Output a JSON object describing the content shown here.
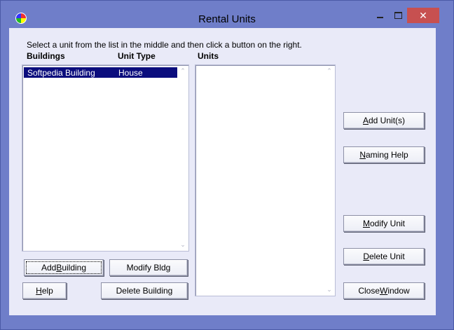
{
  "window": {
    "title": "Rental Units"
  },
  "instructions": "Select a unit from the list in the middle and then click a button on the right.",
  "headers": {
    "buildings": "Buildings",
    "unit_type": "Unit Type",
    "units": "Units"
  },
  "buildings_list": [
    {
      "building": "Softpedia Building",
      "unit_type": "House",
      "selected": true
    }
  ],
  "units_list": [],
  "buttons": {
    "add_building": {
      "pre": "Add ",
      "key": "B",
      "post": "uilding"
    },
    "modify_bldg": {
      "pre": "",
      "key": "",
      "post": "Modify Bldg"
    },
    "help": {
      "pre": "",
      "key": "H",
      "post": "elp"
    },
    "delete_building": {
      "pre": "Delete Building",
      "key": "",
      "post": ""
    },
    "add_units": {
      "pre": "",
      "key": "A",
      "post": "dd Unit(s)"
    },
    "naming_help": {
      "pre": "",
      "key": "N",
      "post": "aming Help"
    },
    "modify_unit": {
      "pre": "",
      "key": "M",
      "post": "odify Unit"
    },
    "delete_unit": {
      "pre": "",
      "key": "D",
      "post": "elete Unit"
    },
    "close_window": {
      "pre": "Close ",
      "key": "W",
      "post": "indow"
    }
  },
  "icons": {
    "app": "app-icon",
    "minimize": "minimize-icon",
    "maximize": "maximize-icon",
    "close": "close-icon"
  },
  "colors": {
    "frame": "#6f7ec9",
    "client": "#e9eaf8",
    "selection": "#0b0d7d",
    "close_button": "#c75050"
  }
}
